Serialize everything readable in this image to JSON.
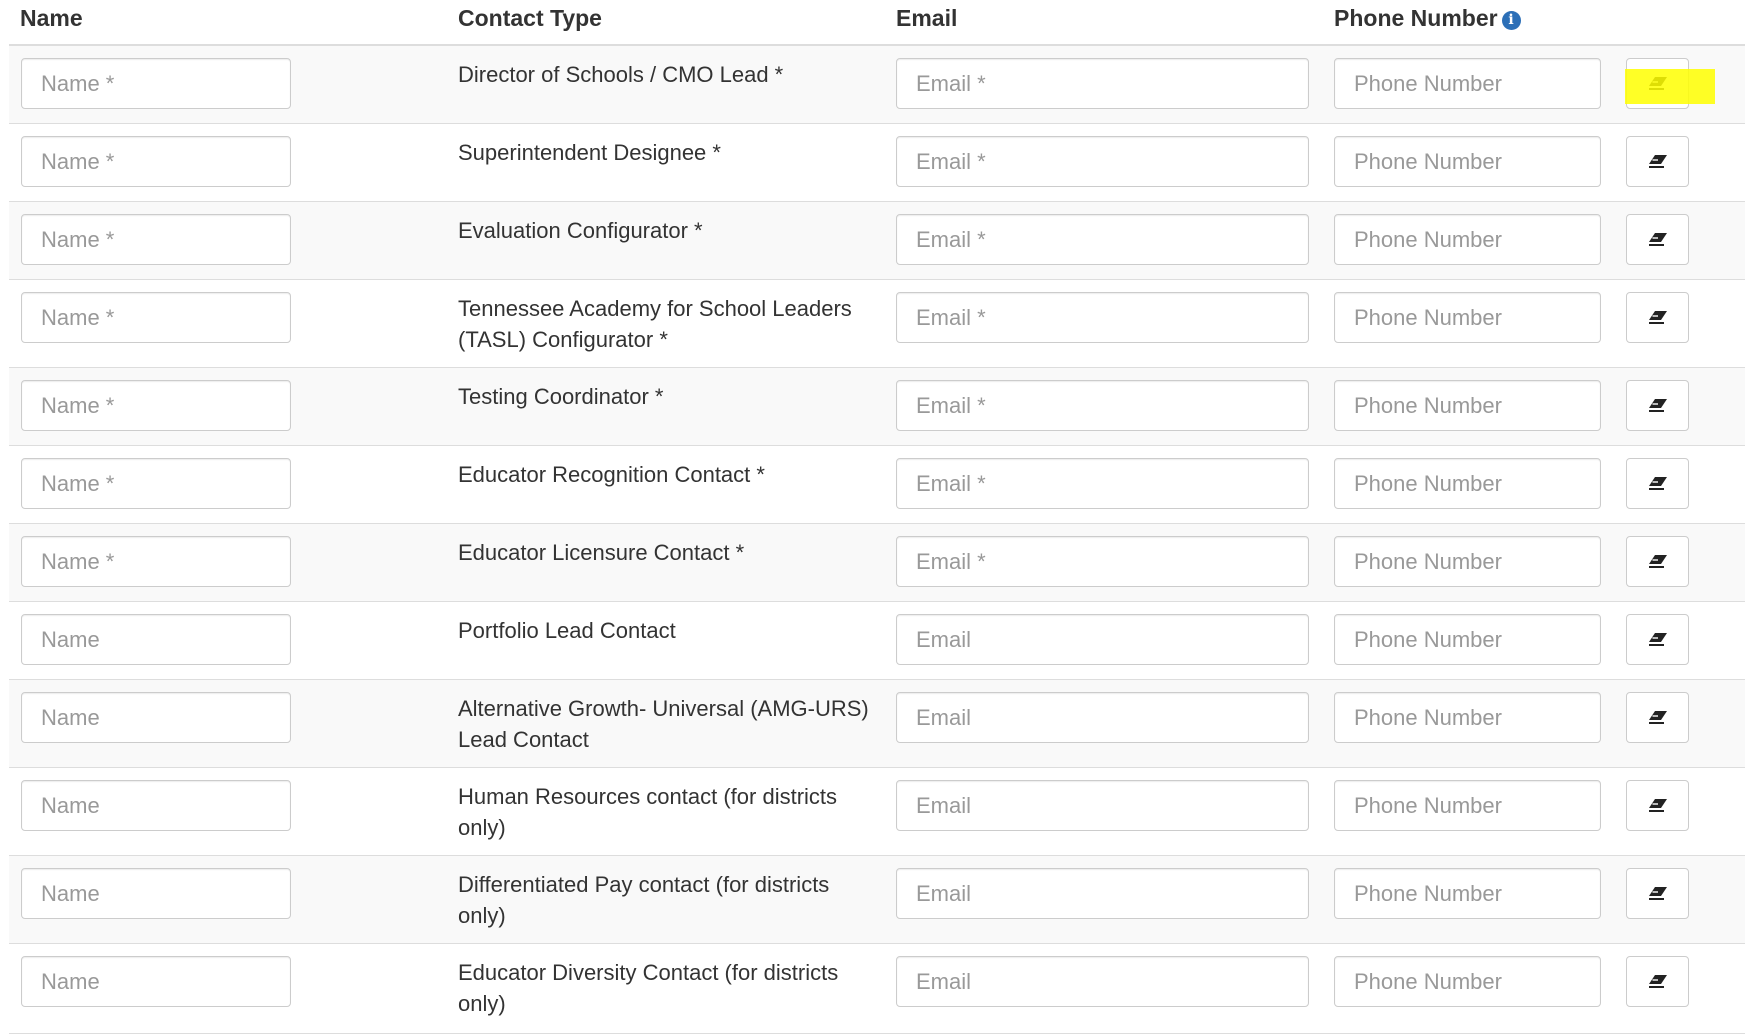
{
  "headers": {
    "name": "Name",
    "contact_type": "Contact Type",
    "email": "Email",
    "phone": "Phone Number"
  },
  "rows": [
    {
      "contact_type": "Director of Schools / CMO Lead *",
      "name_placeholder": "Name *",
      "email_placeholder": "Email *",
      "phone_placeholder": "Phone Number"
    },
    {
      "contact_type": "Superintendent Designee *",
      "name_placeholder": "Name *",
      "email_placeholder": "Email *",
      "phone_placeholder": "Phone Number"
    },
    {
      "contact_type": "Evaluation Configurator *",
      "name_placeholder": "Name *",
      "email_placeholder": "Email *",
      "phone_placeholder": "Phone Number"
    },
    {
      "contact_type": "Tennessee Academy for School Leaders (TASL) Configurator *",
      "name_placeholder": "Name *",
      "email_placeholder": "Email *",
      "phone_placeholder": "Phone Number"
    },
    {
      "contact_type": "Testing Coordinator *",
      "name_placeholder": "Name *",
      "email_placeholder": "Email *",
      "phone_placeholder": "Phone Number"
    },
    {
      "contact_type": "Educator Recognition Contact *",
      "name_placeholder": "Name *",
      "email_placeholder": "Email *",
      "phone_placeholder": "Phone Number"
    },
    {
      "contact_type": "Educator Licensure Contact *",
      "name_placeholder": "Name *",
      "email_placeholder": "Email *",
      "phone_placeholder": "Phone Number"
    },
    {
      "contact_type": "Portfolio Lead Contact",
      "name_placeholder": "Name",
      "email_placeholder": "Email",
      "phone_placeholder": "Phone Number"
    },
    {
      "contact_type": "Alternative Growth- Universal (AMG-URS) Lead Contact",
      "name_placeholder": "Name",
      "email_placeholder": "Email",
      "phone_placeholder": "Phone Number"
    },
    {
      "contact_type": "Human Resources contact (for districts only)",
      "name_placeholder": "Name",
      "email_placeholder": "Email",
      "phone_placeholder": "Phone Number"
    },
    {
      "contact_type": "Differentiated Pay contact (for districts only)",
      "name_placeholder": "Name",
      "email_placeholder": "Email",
      "phone_placeholder": "Phone Number"
    },
    {
      "contact_type": "Educator Diversity Contact (for districts only)",
      "name_placeholder": "Name",
      "email_placeholder": "Email",
      "phone_placeholder": "Phone Number"
    }
  ],
  "icons": {
    "header_info": "info-circle-icon",
    "clear_button": "eraser-icon"
  },
  "colors": {
    "info_icon": "#2c6fb7",
    "highlight": "#ffff00",
    "border": "#dddddd",
    "placeholder": "#999999"
  }
}
